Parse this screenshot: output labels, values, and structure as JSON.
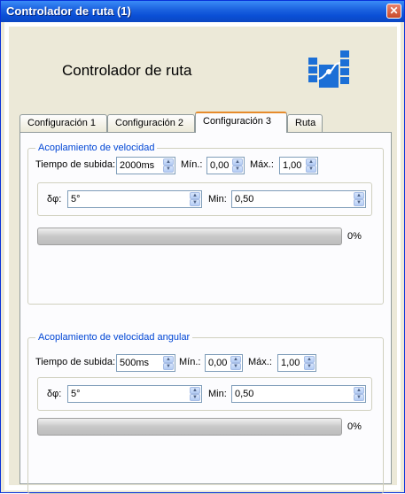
{
  "window": {
    "title": "Controlador de ruta (1)",
    "close_glyph": "✕"
  },
  "header": {
    "title": "Controlador de ruta",
    "logo_icon": "path-controller-icon"
  },
  "tabs": [
    {
      "label": "Configuración 1"
    },
    {
      "label": "Configuración 2"
    },
    {
      "label": "Configuración 3"
    },
    {
      "label": "Ruta"
    }
  ],
  "active_tab": "Configuración 3",
  "groups": [
    {
      "title": "Acoplamiento de velocidad",
      "rise_time_label": "Tiempo de subida:",
      "rise_time_value": "2000ms",
      "min_label": "Mín.:",
      "min_value": "0,00",
      "max_label": "Máx.:",
      "max_value": "1,00",
      "dphi_label": "δφ:",
      "dphi_value": "5°",
      "min2_label": "Min:",
      "min2_value": "0,50",
      "progress": 0,
      "progress_label": "0%"
    },
    {
      "title": "Acoplamiento de velocidad angular",
      "rise_time_label": "Tiempo de subida:",
      "rise_time_value": "500ms",
      "min_label": "Mín.:",
      "min_value": "0,00",
      "max_label": "Máx.:",
      "max_value": "1,00",
      "dphi_label": "δφ:",
      "dphi_value": "5°",
      "min2_label": "Min:",
      "min2_value": "0,50",
      "progress": 0,
      "progress_label": "0%"
    }
  ],
  "colors": {
    "title_bar": "#0a4fd6",
    "accent_tab": "#e68b2c",
    "group_title": "#0046d5"
  }
}
